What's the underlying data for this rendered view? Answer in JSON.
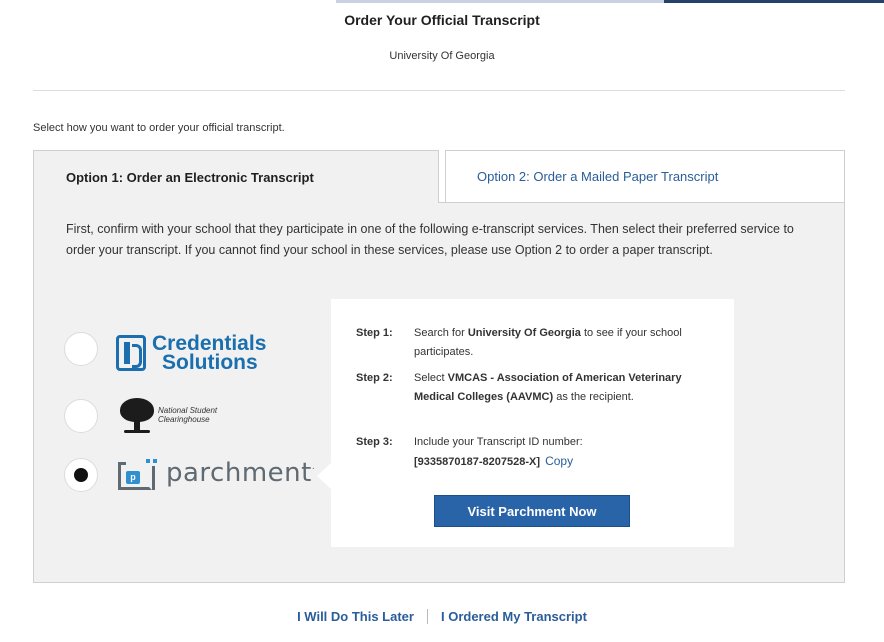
{
  "header": {
    "title": "Order Your Official Transcript",
    "school": "University Of Georgia"
  },
  "instruction": "Select how you want to order your official transcript.",
  "tabs": [
    {
      "label": "Option 1: Order an Electronic Transcript",
      "active": true
    },
    {
      "label": "Option 2: Order a Mailed Paper Transcript",
      "active": false
    }
  ],
  "panel": {
    "intro": "First, confirm with your school that they participate in one of the following e-transcript services. Then select their preferred service to order your transcript. If you cannot find your school in these services, please use Option 2 to order a paper transcript."
  },
  "services": [
    {
      "id": "credentials-solutions",
      "logo_text_1": "Credentials",
      "logo_text_2": "Solutions",
      "selected": false
    },
    {
      "id": "national-student-clearinghouse",
      "logo_text_1": "National Student",
      "logo_text_2": "Clearinghouse",
      "selected": false
    },
    {
      "id": "parchment",
      "logo_text": "parchment",
      "selected": true
    }
  ],
  "steps": {
    "step1_label": "Step 1:",
    "step1_pre": "Search for ",
    "step1_bold": "University Of Georgia",
    "step1_post": " to see if your school participates.",
    "step2_label": "Step 2:",
    "step2_pre": "Select ",
    "step2_bold": "VMCAS - Association of American Veterinary Medical Colleges (AAVMC)",
    "step2_post": " as the recipient.",
    "step3_label": "Step 3:",
    "step3_text": "Include your Transcript ID number:",
    "transcript_id": "[9335870187-8207528-X]",
    "copy_label": "Copy"
  },
  "visit_button": "Visit Parchment Now",
  "footer": {
    "later_link": "I Will Do This Later",
    "ordered_link": "I Ordered My Transcript"
  },
  "colors": {
    "link_blue": "#2a5d9a",
    "button_blue": "#2a64a8",
    "credentials_blue": "#1b6fae",
    "parchment_blue": "#2f8fcf",
    "panel_gray": "#f1f1f1"
  }
}
